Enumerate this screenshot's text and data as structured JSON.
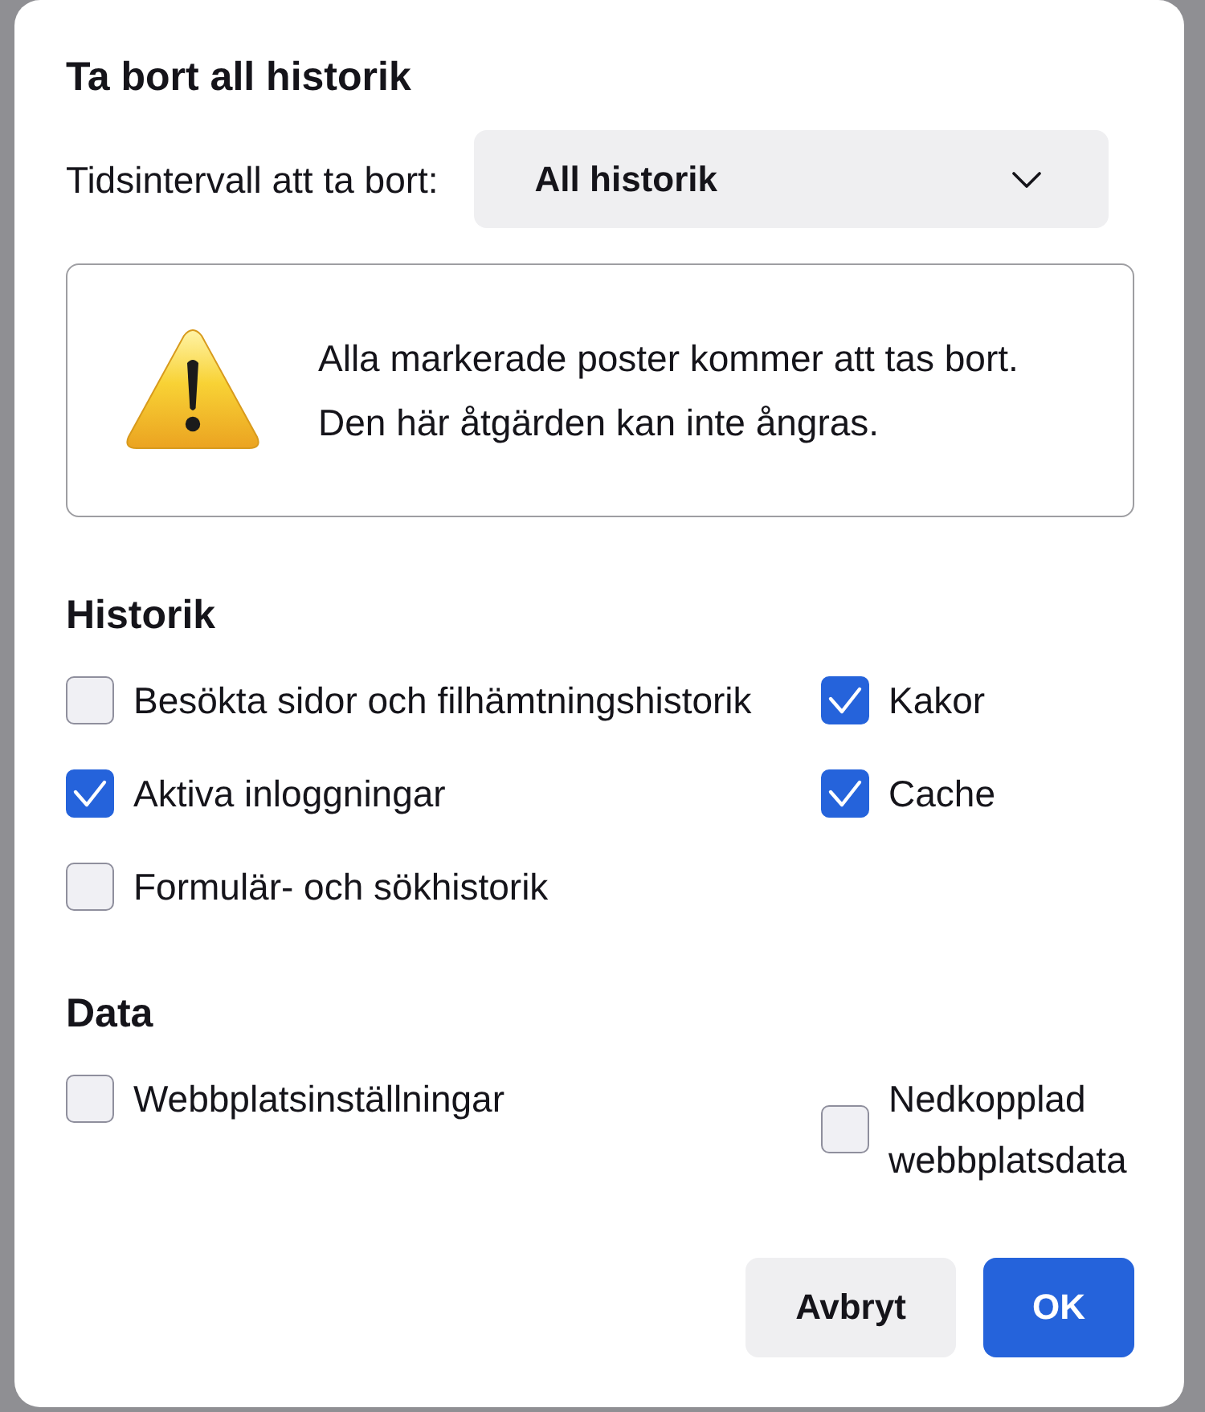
{
  "dialog": {
    "title": "Ta bort all historik"
  },
  "time_range": {
    "label": "Tidsintervall att ta bort:",
    "value": "All historik"
  },
  "warning": {
    "lines": [
      "Alla markerade poster kommer att tas bort.",
      "Den här åtgärden kan inte ångras."
    ]
  },
  "sections": [
    {
      "heading": "Historik",
      "options": [
        {
          "label": "Besökta sidor och filhämtningshistorik",
          "checked": false
        },
        {
          "label": "Kakor",
          "checked": true
        },
        {
          "label": "Aktiva inloggningar",
          "checked": true
        },
        {
          "label": "Cache",
          "checked": true
        },
        {
          "label": "Formulär- och sökhistorik",
          "checked": false
        }
      ]
    },
    {
      "heading": "Data",
      "options": [
        {
          "label": "Webbplatsinställningar",
          "checked": false
        },
        {
          "label": "Nedkopplad webbplatsdata",
          "checked": false
        }
      ]
    }
  ],
  "buttons": [
    {
      "label": "Avbryt",
      "kind": "secondary"
    },
    {
      "label": "OK",
      "kind": "primary"
    }
  ]
}
